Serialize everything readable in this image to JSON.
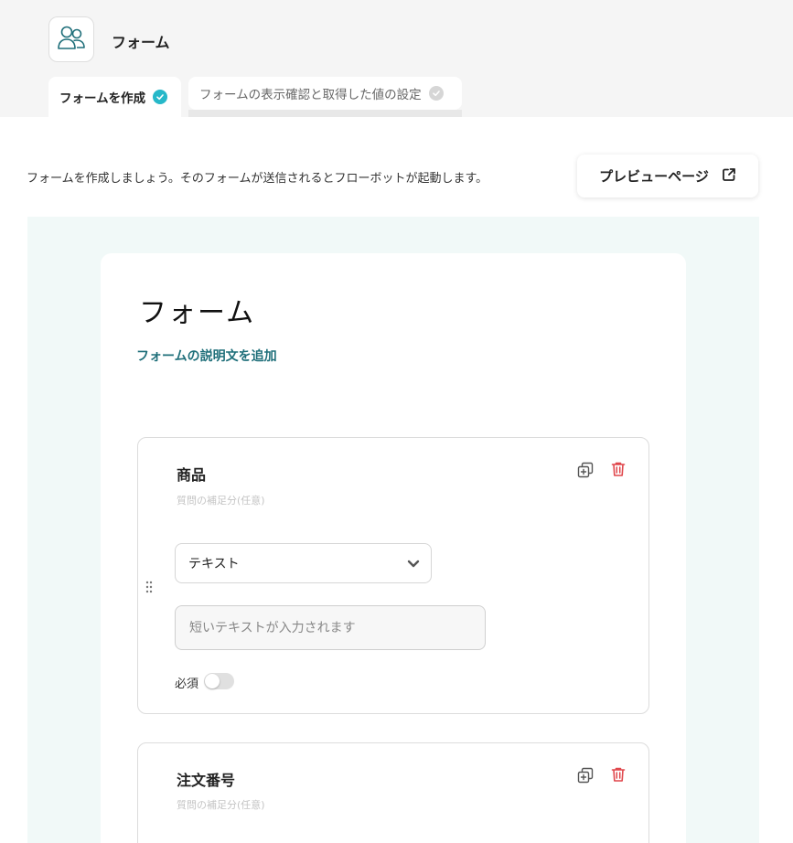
{
  "header": {
    "app_title": "フォーム",
    "app_icon": "users-icon"
  },
  "tabs": [
    {
      "label": "フォームを作成",
      "state": "active",
      "check_color": "#26b8c9"
    },
    {
      "label": "フォームの表示確認と取得した値の設定",
      "state": "inactive",
      "check_color": "#d6d6d6"
    }
  ],
  "intro_text": "フォームを作成しましょう。そのフォームが送信されるとフローボットが起動します。",
  "preview_button": {
    "label": "プレビューページ",
    "icon": "external-link-icon"
  },
  "form": {
    "title": "フォーム",
    "add_description": "フォームの説明文を追加",
    "questions": [
      {
        "title": "商品",
        "hint": "質問の補足分(任意)",
        "type_select": "テキスト",
        "answer_placeholder": "短いテキストが入力されます",
        "required_label": "必須",
        "required": false
      },
      {
        "title": "注文番号",
        "hint": "質問の補足分(任意)"
      }
    ]
  },
  "colors": {
    "accent": "#26b8c9",
    "link": "#1f6f7a",
    "delete": "#e0474c",
    "canvas_bg": "#f1f9f8"
  }
}
